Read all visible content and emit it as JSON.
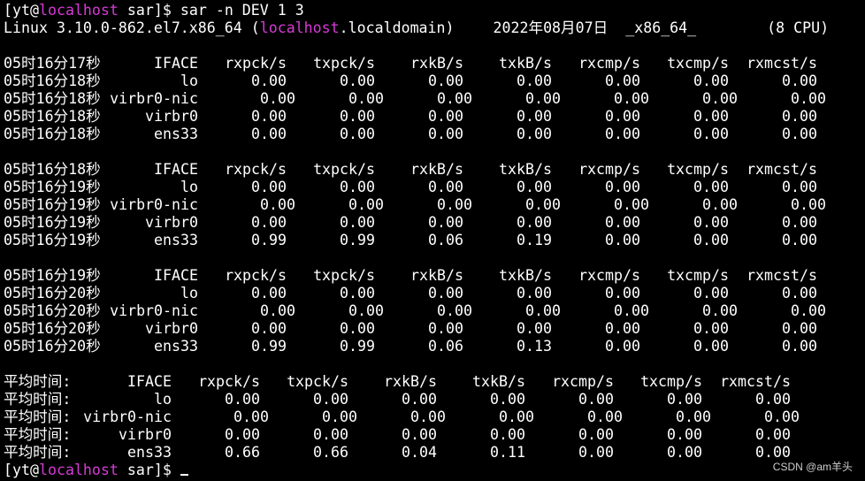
{
  "terminal": {
    "colors": {
      "background": "#000000",
      "text": "#ffffff",
      "hostname": "#d63ad6"
    },
    "prompt": {
      "user": "yt",
      "host": "localhost",
      "cwd": "sar",
      "command": "sar -n DEV 1 3"
    },
    "sysinfo": {
      "kernel": "Linux 3.10.0-862.el7.x86_64 (",
      "host": "localhost",
      "domain": ".localdomain)",
      "date": "2022年08月07日",
      "arch": "_x86_64_",
      "cpus": "(8 CPU)"
    },
    "columns": [
      "IFACE",
      "rxpck/s",
      "txpck/s",
      "rxkB/s",
      "txkB/s",
      "rxcmp/s",
      "txcmp/s",
      "rxmcst/s"
    ],
    "blocks": [
      {
        "header_time": "05时16分17秒",
        "rows": [
          {
            "time": "05时16分18秒",
            "iface": "lo",
            "values": [
              "0.00",
              "0.00",
              "0.00",
              "0.00",
              "0.00",
              "0.00",
              "0.00"
            ]
          },
          {
            "time": "05时16分18秒",
            "iface": "virbr0-nic",
            "values": [
              "0.00",
              "0.00",
              "0.00",
              "0.00",
              "0.00",
              "0.00",
              "0.00"
            ]
          },
          {
            "time": "05时16分18秒",
            "iface": "virbr0",
            "values": [
              "0.00",
              "0.00",
              "0.00",
              "0.00",
              "0.00",
              "0.00",
              "0.00"
            ]
          },
          {
            "time": "05时16分18秒",
            "iface": "ens33",
            "values": [
              "0.00",
              "0.00",
              "0.00",
              "0.00",
              "0.00",
              "0.00",
              "0.00"
            ]
          }
        ]
      },
      {
        "header_time": "05时16分18秒",
        "rows": [
          {
            "time": "05时16分19秒",
            "iface": "lo",
            "values": [
              "0.00",
              "0.00",
              "0.00",
              "0.00",
              "0.00",
              "0.00",
              "0.00"
            ]
          },
          {
            "time": "05时16分19秒",
            "iface": "virbr0-nic",
            "values": [
              "0.00",
              "0.00",
              "0.00",
              "0.00",
              "0.00",
              "0.00",
              "0.00"
            ]
          },
          {
            "time": "05时16分19秒",
            "iface": "virbr0",
            "values": [
              "0.00",
              "0.00",
              "0.00",
              "0.00",
              "0.00",
              "0.00",
              "0.00"
            ]
          },
          {
            "time": "05时16分19秒",
            "iface": "ens33",
            "values": [
              "0.99",
              "0.99",
              "0.06",
              "0.19",
              "0.00",
              "0.00",
              "0.00"
            ]
          }
        ]
      },
      {
        "header_time": "05时16分19秒",
        "rows": [
          {
            "time": "05时16分20秒",
            "iface": "lo",
            "values": [
              "0.00",
              "0.00",
              "0.00",
              "0.00",
              "0.00",
              "0.00",
              "0.00"
            ]
          },
          {
            "time": "05时16分20秒",
            "iface": "virbr0-nic",
            "values": [
              "0.00",
              "0.00",
              "0.00",
              "0.00",
              "0.00",
              "0.00",
              "0.00"
            ]
          },
          {
            "time": "05时16分20秒",
            "iface": "virbr0",
            "values": [
              "0.00",
              "0.00",
              "0.00",
              "0.00",
              "0.00",
              "0.00",
              "0.00"
            ]
          },
          {
            "time": "05时16分20秒",
            "iface": "ens33",
            "values": [
              "0.99",
              "0.99",
              "0.06",
              "0.13",
              "0.00",
              "0.00",
              "0.00"
            ]
          }
        ]
      }
    ],
    "average": {
      "label": "平均时间:",
      "rows": [
        {
          "iface": "lo",
          "values": [
            "0.00",
            "0.00",
            "0.00",
            "0.00",
            "0.00",
            "0.00",
            "0.00"
          ]
        },
        {
          "iface": "virbr0-nic",
          "values": [
            "0.00",
            "0.00",
            "0.00",
            "0.00",
            "0.00",
            "0.00",
            "0.00"
          ]
        },
        {
          "iface": "virbr0",
          "values": [
            "0.00",
            "0.00",
            "0.00",
            "0.00",
            "0.00",
            "0.00",
            "0.00"
          ]
        },
        {
          "iface": "ens33",
          "values": [
            "0.66",
            "0.66",
            "0.04",
            "0.11",
            "0.00",
            "0.00",
            "0.00"
          ]
        }
      ]
    },
    "watermark": "CSDN @am羊头"
  }
}
